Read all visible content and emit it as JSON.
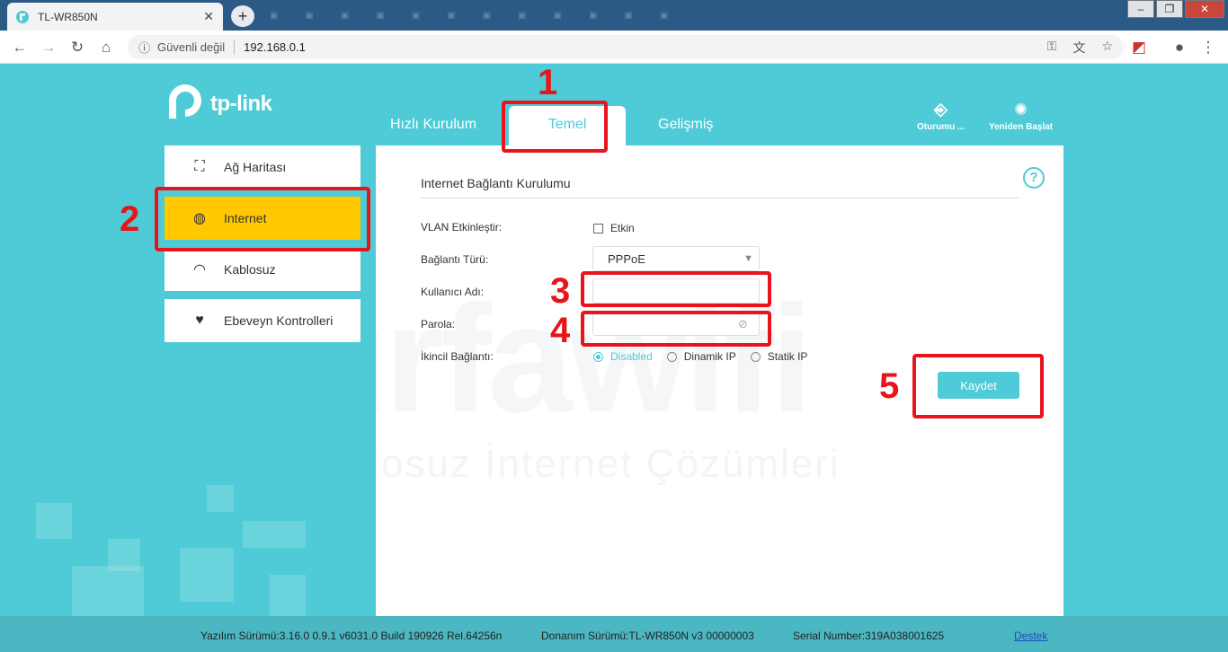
{
  "browser": {
    "tab_title": "TL-WR850N",
    "tab_close": "✕",
    "new_tab": "+",
    "security_label": "Güvenli değil",
    "url": "192.168.0.1",
    "window_minimize": "–",
    "window_maximize": "❐",
    "window_close": "✕"
  },
  "logo": {
    "text": "tp-link"
  },
  "topnav": {
    "tabs": [
      {
        "label": "Hızlı Kurulum"
      },
      {
        "label": "Temel"
      },
      {
        "label": "Gelişmiş"
      }
    ],
    "logout_label": "Oturumu ...",
    "reboot_label": "Yeniden Başlat"
  },
  "sidebar": {
    "items": [
      {
        "label": "Ağ Haritası",
        "icon": "network-map-icon"
      },
      {
        "label": "Internet",
        "icon": "globe-icon"
      },
      {
        "label": "Kablosuz",
        "icon": "wireless-icon"
      },
      {
        "label": "Ebeveyn Kontrolleri",
        "icon": "heart-icon"
      }
    ]
  },
  "form": {
    "section_title": "Internet Bağlantı Kurulumu",
    "help": "?",
    "vlan_label": "VLAN Etkinleştir:",
    "vlan_checkbox_label": "Etkin",
    "connection_type_label": "Bağlantı Türü:",
    "connection_type_value": "PPPoE",
    "username_label": "Kullanıcı Adı:",
    "username_value": "",
    "password_label": "Parola:",
    "password_value": "",
    "secondary_label": "İkincil Bağlantı:",
    "secondary_options": [
      {
        "label": "Disabled",
        "selected": true
      },
      {
        "label": "Dinamik IP",
        "selected": false
      },
      {
        "label": "Statik IP",
        "selected": false
      }
    ],
    "save_label": "Kaydet"
  },
  "watermark": {
    "brand": "urfawifi",
    "tagline": "Kablosuz İnternet Çözümleri"
  },
  "annotations": [
    "1",
    "2",
    "3",
    "4",
    "5"
  ],
  "footer": {
    "firmware": "Yazılım Sürümü:3.16.0 0.9.1 v6031.0 Build 190926 Rel.64256n",
    "hardware": "Donanım Sürümü:TL-WR850N v3 00000003",
    "serial": "Serial Number:319A038001625",
    "support_link": "Destek"
  },
  "colors": {
    "accent": "#4ecbd6",
    "highlight": "#ffc800",
    "annotation": "#e8141b"
  }
}
